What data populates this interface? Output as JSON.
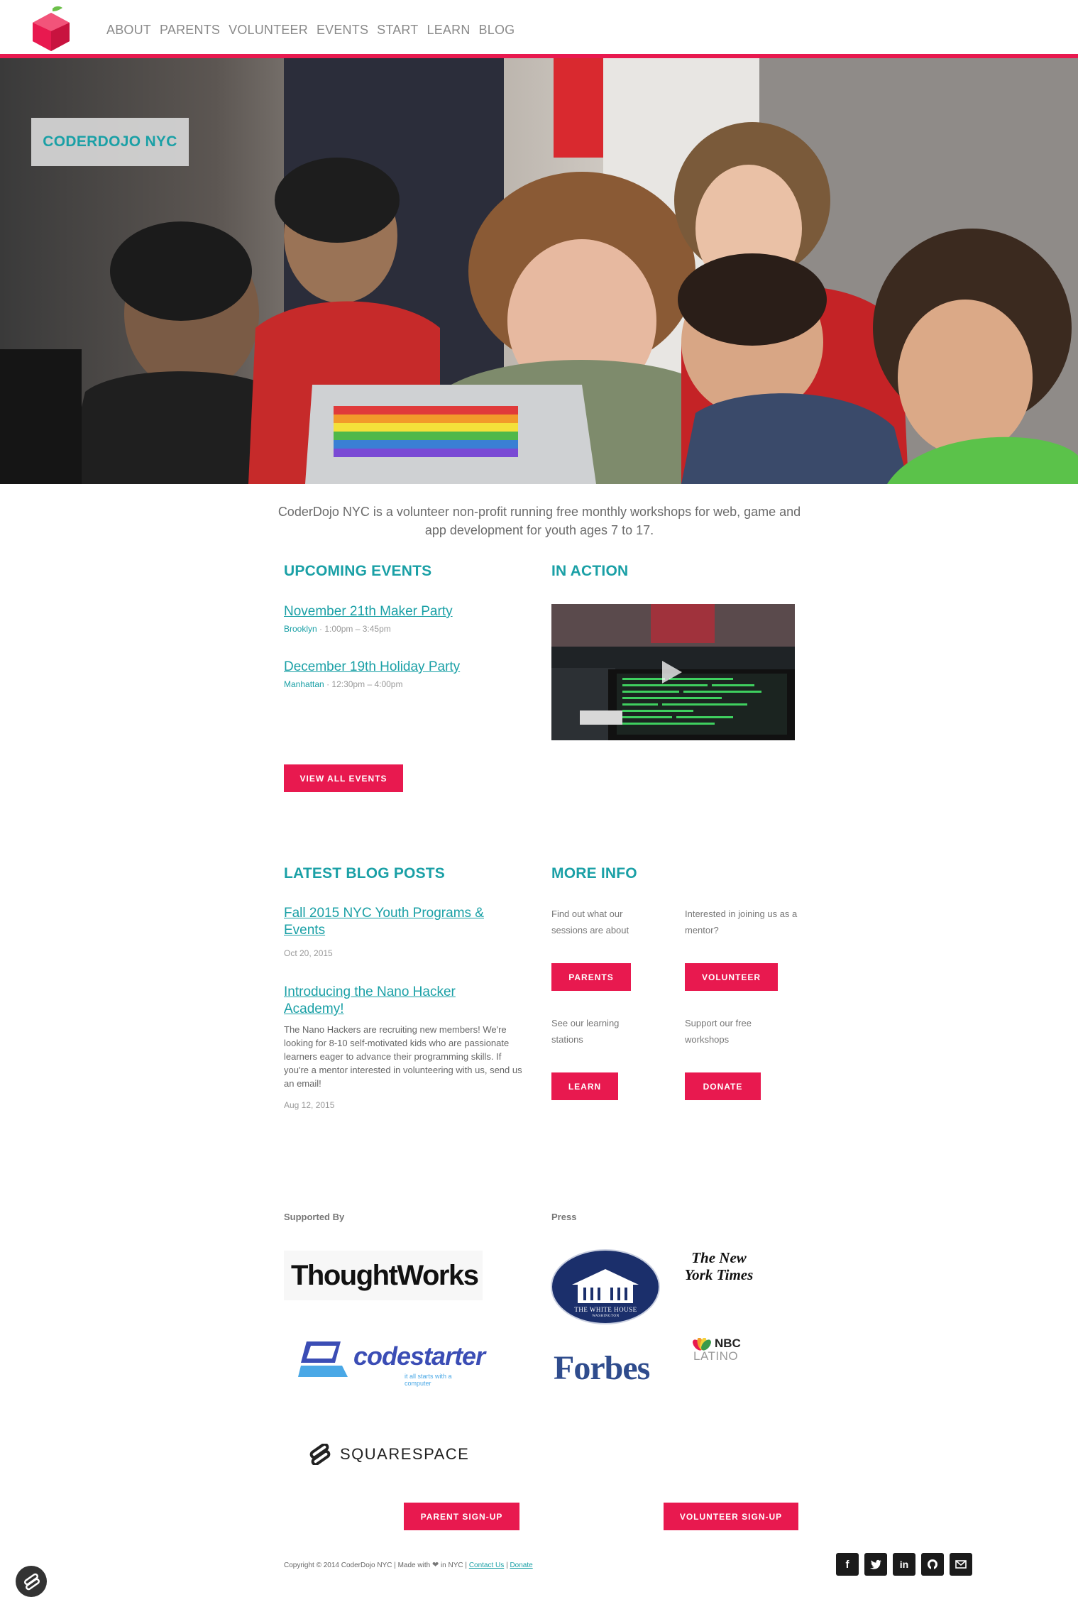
{
  "nav": {
    "items": [
      "ABOUT",
      "PARENTS",
      "VOLUNTEER",
      "EVENTS",
      "START",
      "LEARN",
      "BLOG"
    ]
  },
  "hero": {
    "site_title": "CODERDOJO NYC"
  },
  "intro": "CoderDojo NYC is a volunteer non-profit running free monthly workshops for web, game and app development for youth ages 7 to 17.",
  "upcoming_events": {
    "heading": "UPCOMING EVENTS",
    "events": [
      {
        "title": "November 21th Maker Party",
        "location": "Brooklyn",
        "time": "1:00pm – 3:45pm"
      },
      {
        "title": "December 19th Holiday Party",
        "location": "Manhattan",
        "time": "12:30pm – 4:00pm"
      }
    ],
    "button": "VIEW ALL EVENTS"
  },
  "in_action": {
    "heading": "IN ACTION"
  },
  "blog": {
    "heading": "LATEST BLOG POSTS",
    "posts": [
      {
        "title": "Fall 2015 NYC Youth Programs & Events",
        "date": "Oct 20, 2015"
      },
      {
        "title": "Introducing the Nano Hacker Academy!",
        "excerpt": "The Nano Hackers are recruiting new members! We're looking for 8-10 self-motivated kids who are passionate learners eager to advance their programming skills. If you're a mentor interested in volunteering with us, send us an email!",
        "date": "Aug 12, 2015"
      }
    ]
  },
  "more_info": {
    "heading": "MORE INFO",
    "items": [
      {
        "text": "Find out what our sessions are about",
        "button": "PARENTS"
      },
      {
        "text": "Interested in joining us as a mentor?",
        "button": "VOLUNTEER"
      },
      {
        "text": "See our learning stations",
        "button": "LEARN"
      },
      {
        "text": "Support our free workshops",
        "button": "DONATE"
      }
    ]
  },
  "supported_by": {
    "label": "Supported By",
    "sponsors": [
      "ThoughtWorks",
      "codestarter",
      "it all starts with a computer",
      "SQUARESPACE"
    ]
  },
  "press": {
    "label": "Press",
    "outlets": [
      "THE WHITE HOUSE",
      "WASHINGTON",
      "The New York Times",
      "Forbes",
      "NBC",
      "LATINO"
    ]
  },
  "signup": {
    "parent": "PARENT SIGN-UP",
    "volunteer": "VOLUNTEER SIGN-UP"
  },
  "footer": {
    "copyright_prefix": "Copyright © 2014 CoderDojo NYC | Made with",
    "copyright_suffix": "in NYC",
    "contact": "Contact Us",
    "donate": "Donate",
    "social": [
      "f",
      "t",
      "in",
      "gh",
      "mail"
    ]
  },
  "colors": {
    "accent": "#e8194f",
    "teal": "#1aa0a6"
  }
}
